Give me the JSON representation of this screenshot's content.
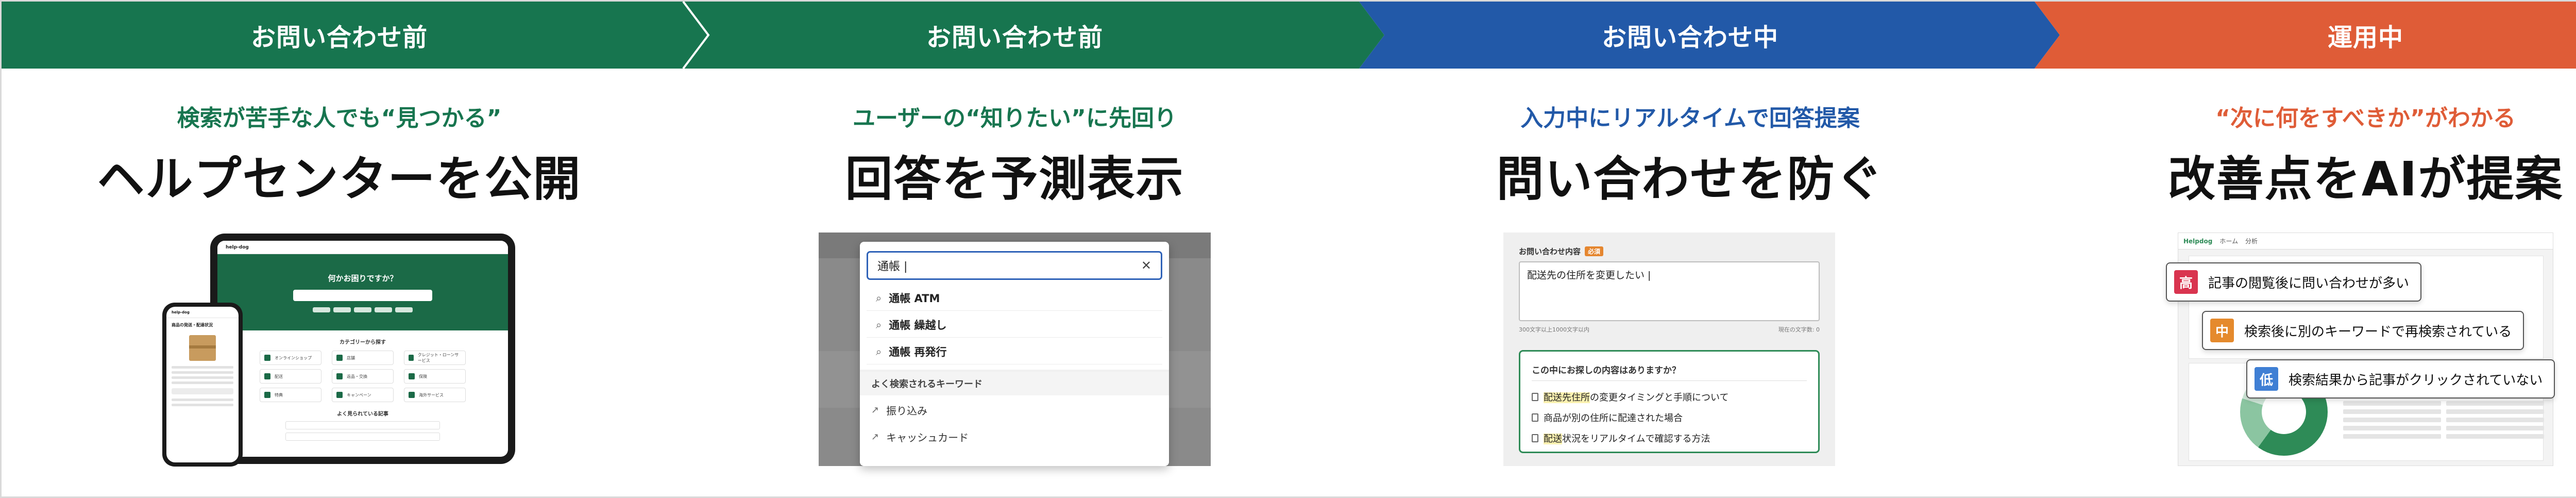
{
  "colors": {
    "green": "#17754f",
    "blue": "#2259a8",
    "orange": "#df5c37",
    "gray_border": "#d9d9d9"
  },
  "steps": [
    {
      "label": "お問い合わせ前",
      "subtitle": "検索が苦手な人でも“見つかる”",
      "headline": "ヘルプセンターを公開"
    },
    {
      "label": "お問い合わせ前",
      "subtitle": "ユーザーの“知りたい”に先回り",
      "headline": "回答を予測表示"
    },
    {
      "label": "お問い合わせ中",
      "subtitle": "入力中にリアルタイムで回答提案",
      "headline": "問い合わせを防ぐ"
    },
    {
      "label": "運用中",
      "subtitle": "“次に何をすべきか”がわかる",
      "headline": "改善点をAIが提案"
    }
  ],
  "helpcenter": {
    "logo": "help-dog",
    "hero_title": "何かお困りですか？",
    "category_title": "カテゴリーから探す",
    "categories": [
      "オンラインショップ",
      "店舗",
      "クレジット・ローンサービス",
      "配送",
      "返品・交換",
      "保険",
      "特典",
      "キャンペーン",
      "海外サービス"
    ],
    "faq_title": "よく見られている記事",
    "phone_title": "商品の発送・配達状況"
  },
  "autocomplete": {
    "query": "通帳 |",
    "clear": "✕",
    "suggestions": [
      "通帳 ATM",
      "通帳 繰越し",
      "通帳 再発行"
    ],
    "keywords_header": "よく検索されるキーワード",
    "keywords": [
      "振り込み",
      "キャッシュカード"
    ]
  },
  "inquiry_form": {
    "label": "お問い合わせ内容",
    "required": "必須",
    "text": "配送先の住所を変更したい |",
    "note_left": "300文字以上1000文字以内",
    "note_right": "現在の文字数: 0",
    "question": "この中にお探しの内容はありますか？",
    "results": [
      {
        "highlight": "配送先住所",
        "rest": "の変更タイミングと手順について"
      },
      {
        "highlight": "",
        "rest": "商品が別の住所に配達された場合"
      },
      {
        "highlight": "配送",
        "rest": "状況をリアルタイムで確認する方法"
      }
    ]
  },
  "dashboard": {
    "logo": "Helpdog",
    "tabs": [
      "ホーム",
      "分析"
    ],
    "alerts": [
      {
        "level": "高",
        "text": "記事の閲覧後に問い合わせが多い",
        "color": "#d9344f"
      },
      {
        "level": "中",
        "text": "検索後に別のキーワードで再検索されている",
        "color": "#e58a2d"
      },
      {
        "level": "低",
        "text": "検索結果から記事がクリックされていない",
        "color": "#3f7fd4"
      }
    ]
  }
}
